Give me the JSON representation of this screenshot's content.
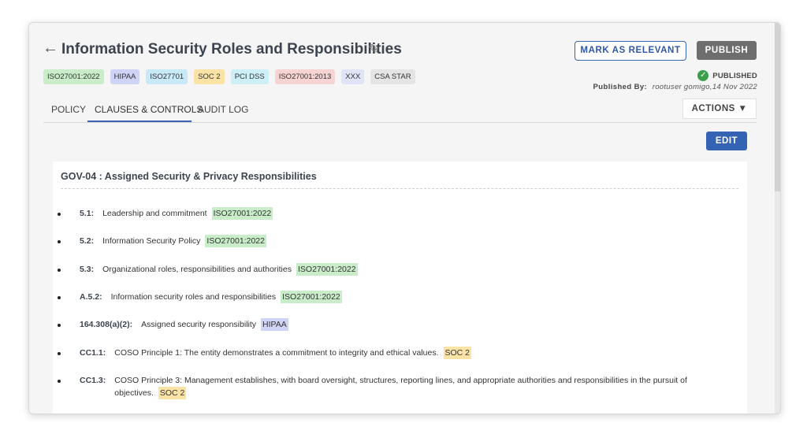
{
  "header": {
    "back_icon": "arrow-left-icon",
    "title": "Information Security Roles and Responsibilities",
    "edit_icon": "pencil-icon",
    "mark_relevant_label": "MARK AS RELEVANT",
    "publish_label": "PUBLISH"
  },
  "tags": [
    {
      "label": "ISO27001:2022",
      "color": "#c9ecc9"
    },
    {
      "label": "HIPAA",
      "color": "#cfd4f7"
    },
    {
      "label": "ISO27701",
      "color": "#c8e9f7"
    },
    {
      "label": "SOC 2",
      "color": "#fbe3a6"
    },
    {
      "label": "PCI DSS",
      "color": "#cdeff7"
    },
    {
      "label": "ISO27001:2013",
      "color": "#f7d3d3"
    },
    {
      "label": "XXX",
      "color": "#dfe4f7"
    },
    {
      "label": "CSA STAR",
      "color": "#e4e4e4"
    }
  ],
  "status": {
    "icon": "check-circle-icon",
    "text": "PUBLISHED",
    "published_by_label": "Published By:",
    "published_by_value": "rootuser gomigo,14 Nov 2022"
  },
  "tabs": [
    {
      "label": "POLICY",
      "active": false
    },
    {
      "label": "CLAUSES & CONTROLS",
      "active": true
    },
    {
      "label": "AUDIT LOG",
      "active": false
    }
  ],
  "actions_label": "ACTIONS ▼",
  "edit_label": "EDIT",
  "control": {
    "title": "GOV-04 :  Assigned Security & Privacy Responsibilities"
  },
  "clauses": [
    {
      "code": "5.1:",
      "text": "Leadership and commitment",
      "tag": "ISO27001:2022",
      "tag_color": "#c9ecc9"
    },
    {
      "code": "5.2:",
      "text": "Information Security Policy",
      "tag": "ISO27001:2022",
      "tag_color": "#c9ecc9"
    },
    {
      "code": "5.3:",
      "text": "Organizational roles, responsibilities and authorities",
      "tag": "ISO27001:2022",
      "tag_color": "#c9ecc9"
    },
    {
      "code": "A.5.2:",
      "text": "Information security roles and responsibilities",
      "tag": "ISO27001:2022",
      "tag_color": "#c9ecc9"
    },
    {
      "code": "164.308(a)(2):",
      "text": "Assigned security responsibility",
      "tag": "HIPAA",
      "tag_color": "#cfd4f7"
    },
    {
      "code": "CC1.1:",
      "text": "COSO Principle 1: The entity demonstrates a commitment to integrity and ethical values.",
      "tag": "SOC 2",
      "tag_color": "#fbe3a6"
    },
    {
      "code": "CC1.3:",
      "text": "COSO Principle 3: Management establishes, with board oversight, structures, reporting lines, and appropriate authorities and responsibilities in the pursuit of objectives.",
      "tag": "SOC 2",
      "tag_color": "#fbe3a6"
    }
  ]
}
